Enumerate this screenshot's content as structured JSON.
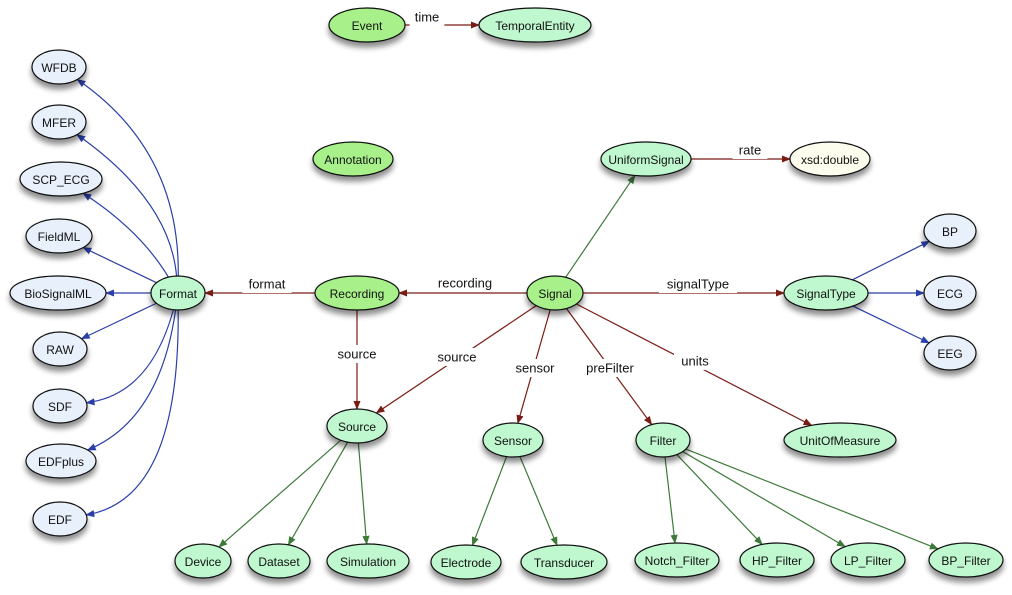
{
  "diagram": {
    "colors": {
      "class_bright": "#a8f08a",
      "class_light": "#bff7cf",
      "instance": "#e8f0fb",
      "datatype": "#fdfdee",
      "property_edge": "#7a1c14",
      "subclass_edge": "#3d7a3a",
      "instance_edge": "#2b3fa8"
    },
    "nodes": [
      {
        "id": "Event",
        "label": "Event",
        "kind": "class_bright"
      },
      {
        "id": "TemporalEntity",
        "label": "TemporalEntity",
        "kind": "class_light"
      },
      {
        "id": "Annotation",
        "label": "Annotation",
        "kind": "class_bright"
      },
      {
        "id": "UniformSignal",
        "label": "UniformSignal",
        "kind": "class_light"
      },
      {
        "id": "xsd_double",
        "label": "xsd:double",
        "kind": "datatype"
      },
      {
        "id": "Recording",
        "label": "Recording",
        "kind": "class_bright"
      },
      {
        "id": "Signal",
        "label": "Signal",
        "kind": "class_bright"
      },
      {
        "id": "Format",
        "label": "Format",
        "kind": "class_light"
      },
      {
        "id": "SignalType",
        "label": "SignalType",
        "kind": "class_light"
      },
      {
        "id": "BP",
        "label": "BP",
        "kind": "instance"
      },
      {
        "id": "ECG",
        "label": "ECG",
        "kind": "instance"
      },
      {
        "id": "EEG",
        "label": "EEG",
        "kind": "instance"
      },
      {
        "id": "WFDB",
        "label": "WFDB",
        "kind": "instance"
      },
      {
        "id": "MFER",
        "label": "MFER",
        "kind": "instance"
      },
      {
        "id": "SCP_ECG",
        "label": "SCP_ECG",
        "kind": "instance"
      },
      {
        "id": "FieldML",
        "label": "FieldML",
        "kind": "instance"
      },
      {
        "id": "BioSignalML",
        "label": "BioSignalML",
        "kind": "instance"
      },
      {
        "id": "RAW",
        "label": "RAW",
        "kind": "instance"
      },
      {
        "id": "SDF",
        "label": "SDF",
        "kind": "instance"
      },
      {
        "id": "EDFplus",
        "label": "EDFplus",
        "kind": "instance"
      },
      {
        "id": "EDF",
        "label": "EDF",
        "kind": "instance"
      },
      {
        "id": "Source",
        "label": "Source",
        "kind": "class_light"
      },
      {
        "id": "Sensor",
        "label": "Sensor",
        "kind": "class_light"
      },
      {
        "id": "Filter",
        "label": "Filter",
        "kind": "class_light"
      },
      {
        "id": "UnitOfMeasure",
        "label": "UnitOfMeasure",
        "kind": "class_light"
      },
      {
        "id": "Device",
        "label": "Device",
        "kind": "class_light"
      },
      {
        "id": "Dataset",
        "label": "Dataset",
        "kind": "class_light"
      },
      {
        "id": "Simulation",
        "label": "Simulation",
        "kind": "class_light"
      },
      {
        "id": "Electrode",
        "label": "Electrode",
        "kind": "class_light"
      },
      {
        "id": "Transducer",
        "label": "Transducer",
        "kind": "class_light"
      },
      {
        "id": "Notch_Filter",
        "label": "Notch_Filter",
        "kind": "class_light"
      },
      {
        "id": "HP_Filter",
        "label": "HP_Filter",
        "kind": "class_light"
      },
      {
        "id": "LP_Filter",
        "label": "LP_Filter",
        "kind": "class_light"
      },
      {
        "id": "BP_Filter",
        "label": "BP_Filter",
        "kind": "class_light"
      }
    ],
    "edges": [
      {
        "from": "Event",
        "to": "TemporalEntity",
        "label": "time",
        "kind": "property_edge"
      },
      {
        "from": "UniformSignal",
        "to": "xsd_double",
        "label": "rate",
        "kind": "property_edge"
      },
      {
        "from": "Signal",
        "to": "UniformSignal",
        "label": "",
        "kind": "subclass_edge"
      },
      {
        "from": "Signal",
        "to": "Recording",
        "label": "recording",
        "kind": "property_edge"
      },
      {
        "from": "Recording",
        "to": "Format",
        "label": "format",
        "kind": "property_edge"
      },
      {
        "from": "Signal",
        "to": "SignalType",
        "label": "signalType",
        "kind": "property_edge"
      },
      {
        "from": "Recording",
        "to": "Source",
        "label": "source",
        "kind": "property_edge"
      },
      {
        "from": "Signal",
        "to": "Source",
        "label": "source",
        "kind": "property_edge"
      },
      {
        "from": "Signal",
        "to": "Sensor",
        "label": "sensor",
        "kind": "property_edge"
      },
      {
        "from": "Signal",
        "to": "Filter",
        "label": "preFilter",
        "kind": "property_edge"
      },
      {
        "from": "Signal",
        "to": "UnitOfMeasure",
        "label": "units",
        "kind": "property_edge"
      },
      {
        "from": "SignalType",
        "to": "BP",
        "label": "",
        "kind": "instance_edge"
      },
      {
        "from": "SignalType",
        "to": "ECG",
        "label": "",
        "kind": "instance_edge"
      },
      {
        "from": "SignalType",
        "to": "EEG",
        "label": "",
        "kind": "instance_edge"
      },
      {
        "from": "Format",
        "to": "WFDB",
        "label": "",
        "kind": "instance_edge"
      },
      {
        "from": "Format",
        "to": "MFER",
        "label": "",
        "kind": "instance_edge"
      },
      {
        "from": "Format",
        "to": "SCP_ECG",
        "label": "",
        "kind": "instance_edge"
      },
      {
        "from": "Format",
        "to": "FieldML",
        "label": "",
        "kind": "instance_edge"
      },
      {
        "from": "Format",
        "to": "BioSignalML",
        "label": "",
        "kind": "instance_edge"
      },
      {
        "from": "Format",
        "to": "RAW",
        "label": "",
        "kind": "instance_edge"
      },
      {
        "from": "Format",
        "to": "SDF",
        "label": "",
        "kind": "instance_edge"
      },
      {
        "from": "Format",
        "to": "EDFplus",
        "label": "",
        "kind": "instance_edge"
      },
      {
        "from": "Format",
        "to": "EDF",
        "label": "",
        "kind": "instance_edge"
      },
      {
        "from": "Source",
        "to": "Device",
        "label": "",
        "kind": "subclass_edge"
      },
      {
        "from": "Source",
        "to": "Dataset",
        "label": "",
        "kind": "subclass_edge"
      },
      {
        "from": "Source",
        "to": "Simulation",
        "label": "",
        "kind": "subclass_edge"
      },
      {
        "from": "Sensor",
        "to": "Electrode",
        "label": "",
        "kind": "subclass_edge"
      },
      {
        "from": "Sensor",
        "to": "Transducer",
        "label": "",
        "kind": "subclass_edge"
      },
      {
        "from": "Filter",
        "to": "Notch_Filter",
        "label": "",
        "kind": "subclass_edge"
      },
      {
        "from": "Filter",
        "to": "HP_Filter",
        "label": "",
        "kind": "subclass_edge"
      },
      {
        "from": "Filter",
        "to": "LP_Filter",
        "label": "",
        "kind": "subclass_edge"
      },
      {
        "from": "Filter",
        "to": "BP_Filter",
        "label": "",
        "kind": "subclass_edge"
      }
    ]
  }
}
